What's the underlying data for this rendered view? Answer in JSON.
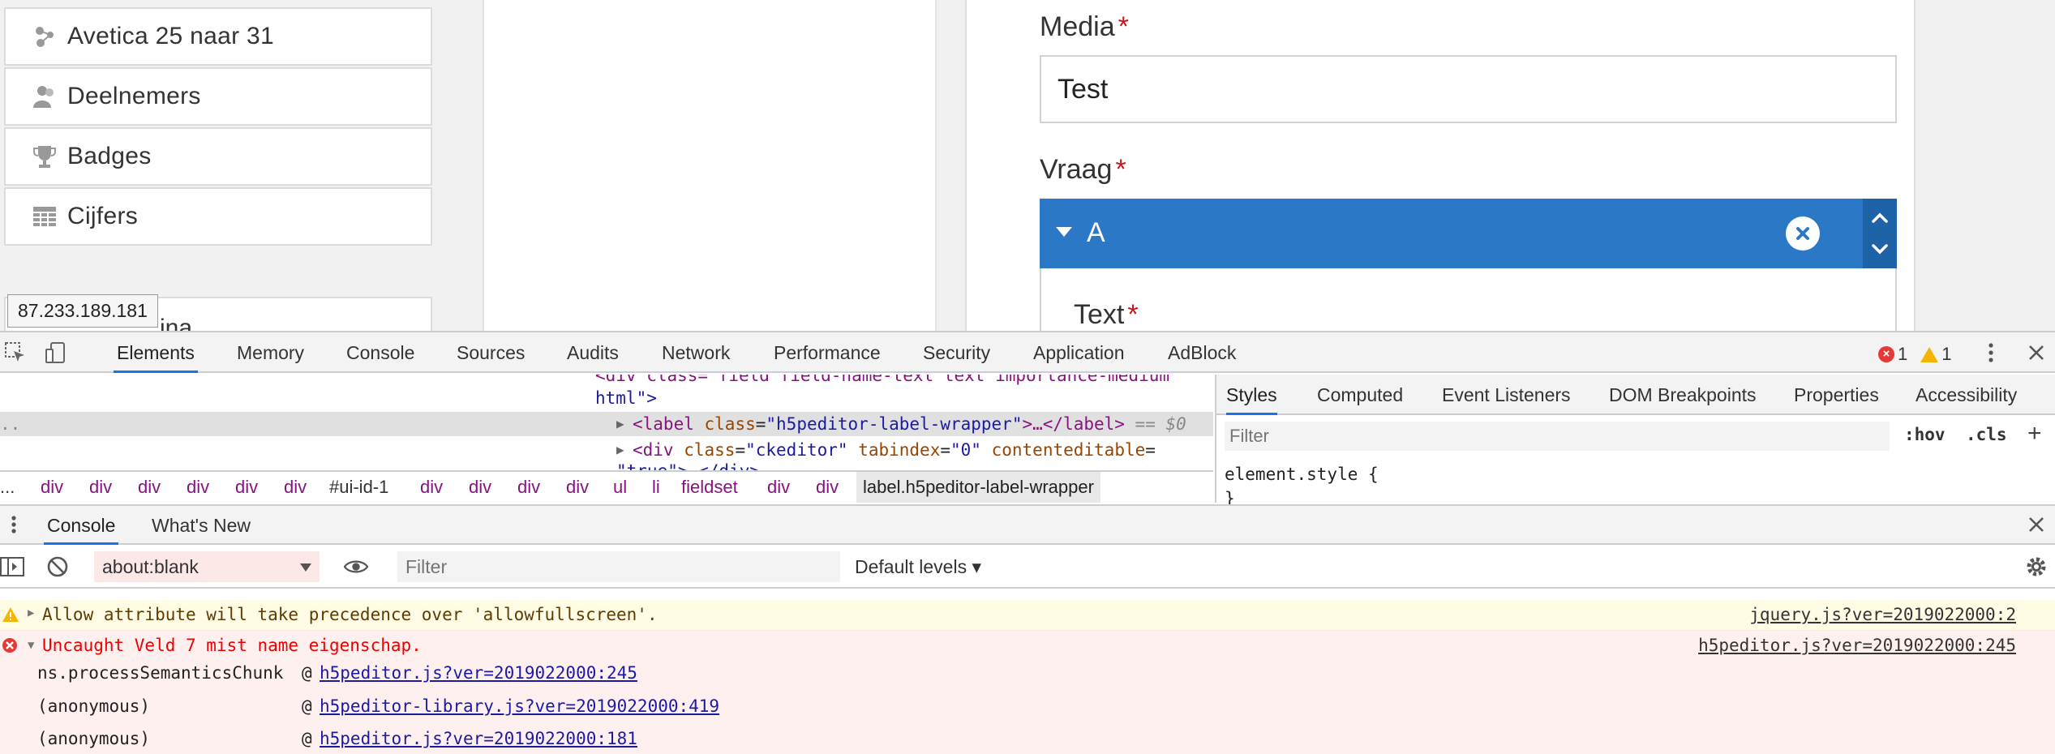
{
  "sidebar": {
    "items": [
      {
        "label": "Avetica 25 naar 31",
        "icon": "network-icon"
      },
      {
        "label": "Deelnemers",
        "icon": "users-icon"
      },
      {
        "label": "Badges",
        "icon": "trophy-icon"
      },
      {
        "label": "Cijfers",
        "icon": "grid-icon"
      }
    ],
    "next_item_partial": "ina"
  },
  "tooltip": {
    "ip": "87.233.189.181"
  },
  "form": {
    "media_label": "Media",
    "media_value": "Test",
    "vraag_label": "Vraag",
    "vraag_item_title": "A",
    "text_label": "Text",
    "required_mark": "*"
  },
  "devtools": {
    "tabs": [
      "Elements",
      "Memory",
      "Console",
      "Sources",
      "Audits",
      "Network",
      "Performance",
      "Security",
      "Application",
      "AdBlock"
    ],
    "active_tab": "Elements",
    "error_count": "1",
    "warning_count": "1",
    "elements": {
      "line0_partial": "<div class=\"field field-name-text text importance-medium",
      "line1": "html\">",
      "line2_tag_open": "<label",
      "line2_attr": "class",
      "line2_val": "\"h5peditor-label-wrapper\"",
      "line2_mid": ">…</",
      "line2_tag_close": "label>",
      "line2_suffix": " == $0",
      "line3_tag": "<div",
      "line3_attr1": "class",
      "line3_val1": "\"ckeditor\"",
      "line3_attr2": "tabindex",
      "line3_val2": "\"0\"",
      "line3_attr3": "contenteditable",
      "line4_partial": "\"true\">…</div>",
      "left_ellipsis": ".."
    },
    "breadcrumb": [
      "...",
      "div",
      "div",
      "div",
      "div",
      "div",
      "div",
      "#ui-id-1",
      "div",
      "div",
      "div",
      "div",
      "ul",
      "li",
      "fieldset",
      "div",
      "div",
      "label.h5peditor-label-wrapper"
    ],
    "styles": {
      "tabs": [
        "Styles",
        "Computed",
        "Event Listeners",
        "DOM Breakpoints",
        "Properties",
        "Accessibility"
      ],
      "active_tab": "Styles",
      "filter_placeholder": "Filter",
      "hov": ":hov",
      "cls": ".cls",
      "plus": "+",
      "rule_selector": "element.style {",
      "rule_close": "}"
    },
    "drawer": {
      "tabs": [
        "Console",
        "What's New"
      ],
      "active_tab": "Console",
      "context": "about:blank",
      "filter_placeholder": "Filter",
      "levels": "Default levels ▾"
    },
    "console": {
      "warning": {
        "text": "Allow attribute will take precedence over 'allowfullscreen'.",
        "source": "jquery.js?ver=2019022000:2"
      },
      "error": {
        "text": "Uncaught Veld 7 mist name eigenschap.",
        "source": "h5peditor.js?ver=2019022000:245",
        "stack": [
          {
            "fn": "ns.processSemanticsChunk",
            "at": "@",
            "link": "h5peditor.js?ver=2019022000:245"
          },
          {
            "fn": "(anonymous)",
            "at": "@",
            "link": "h5peditor-library.js?ver=2019022000:419"
          },
          {
            "fn": "(anonymous)",
            "at": "@",
            "link": "h5peditor.js?ver=2019022000:181"
          }
        ]
      }
    }
  },
  "colors": {
    "accent": "#2a78c6",
    "devtools_active": "#1a73e8",
    "error": "#e00",
    "warning_bg": "#fffbe5",
    "error_bg": "#fff0f0"
  }
}
